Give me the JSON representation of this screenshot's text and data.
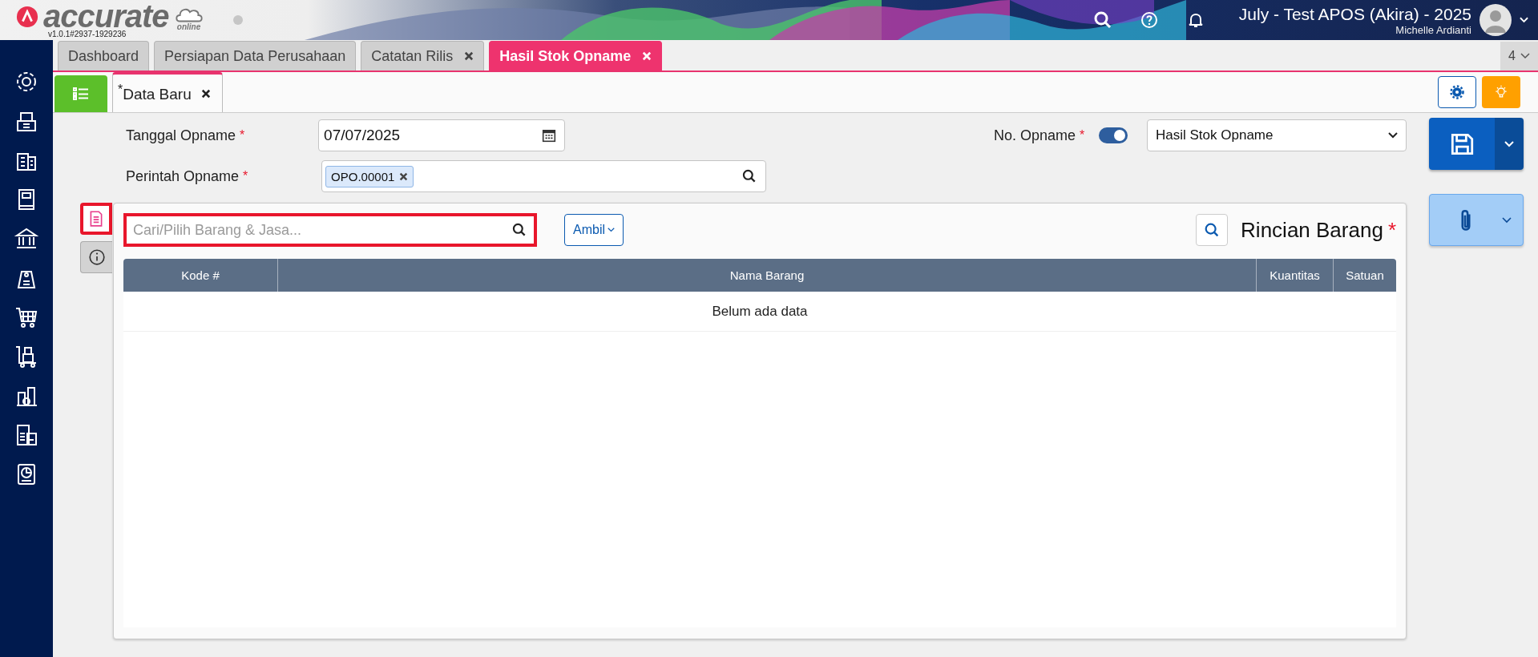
{
  "header": {
    "logo_name": "accurate",
    "logo_sub": "online",
    "version": "v1.0.1#2937-1929236",
    "company": "July - Test APOS (Akira) - 2025",
    "user": "Michelle Ardianti"
  },
  "tabs": [
    {
      "label": "Dashboard",
      "closable": false,
      "selected": false
    },
    {
      "label": "Persiapan Data Perusahaan",
      "closable": false,
      "selected": false
    },
    {
      "label": "Catatan Rilis",
      "closable": true,
      "selected": false
    },
    {
      "label": "Hasil Stok Opname",
      "closable": true,
      "selected": true
    }
  ],
  "tab_count": "4",
  "subtabs": [
    {
      "label": "$^{*}$Data Baru",
      "closable": true,
      "selected": true
    }
  ],
  "form": {
    "date_label": "Tanggal Opname",
    "date_value": "07/07/2025",
    "order_label": "Perintah Opname",
    "order_chips": [
      "OPO.00001"
    ],
    "number_label": "No. Opname",
    "auto_number": true,
    "number_value": "Hasil Stok Opname",
    "required_mark": "*"
  },
  "side_tabs": [
    {
      "kind": "document",
      "selected": true,
      "highlighted": true
    },
    {
      "kind": "info",
      "selected": false,
      "highlighted": false
    }
  ],
  "detail": {
    "search_placeholder": "Cari/Pilih Barang & Jasa...",
    "search_highlighted": true,
    "take_button": "Ambil",
    "title": "Rincian Barang",
    "required_mark": "*",
    "columns": [
      "Kode #",
      "Nama Barang",
      "Kuantitas",
      "Satuan"
    ],
    "empty_text": "Belum ada data"
  }
}
